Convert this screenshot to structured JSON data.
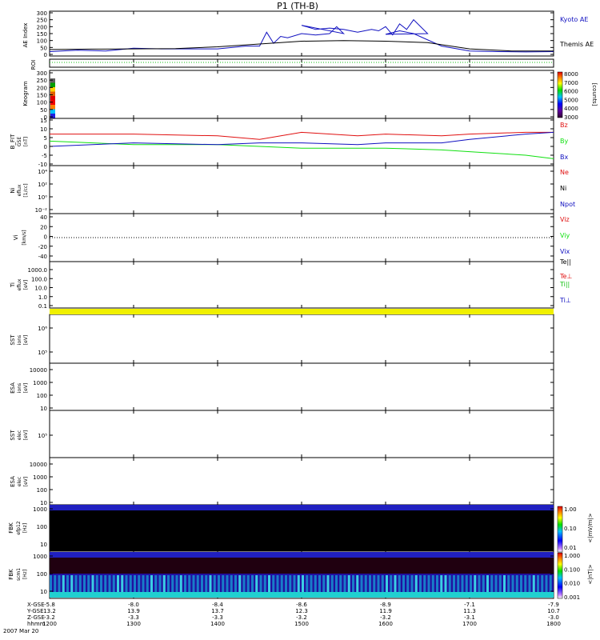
{
  "title": "P1 (TH-B)",
  "date_label": "2007 Mar 20",
  "colors": {
    "red": "#e01010",
    "green": "#10e010",
    "blue": "#1010c0",
    "black": "#000000",
    "yellow": "#f0f000",
    "cyan": "#20d0d0",
    "dark_blue": "#2020c0"
  },
  "x_axis": {
    "tick_labels": [
      "1200",
      "1300",
      "1400",
      "1500",
      "1600",
      "1700",
      "1800"
    ],
    "row_labels": [
      "X-GSE",
      "Y-GSE",
      "Z-GSE",
      "hhmm"
    ],
    "x_gse": [
      "-5.8",
      "-8.0",
      "-8.4",
      "-8.6",
      "-8.9",
      "-7.1",
      "-7.9"
    ],
    "y_gse": [
      "13.2",
      "13.9",
      "13.7",
      "12.3",
      "11.9",
      "11.3",
      "10.7"
    ],
    "z_gse": [
      "-3.2",
      "-3.3",
      "-3.3",
      "-3.2",
      "-3.2",
      "-3.1",
      "-3.0"
    ]
  },
  "panels": {
    "ae": {
      "ylabel": "AE Index",
      "ticks": [
        "300",
        "250",
        "200",
        "150",
        "100",
        "50",
        "0"
      ],
      "legend": [
        "Kyoto AE",
        "Themis AE"
      ]
    },
    "roi": {
      "ylabel": "ROI"
    },
    "keo": {
      "ylabel": "Keogram",
      "ticks": [
        "300",
        "250",
        "200",
        "150",
        "100",
        "50",
        "0"
      ],
      "colorbar": {
        "unit": "[counts]",
        "ticks": [
          "8000",
          "7000",
          "6000",
          "5000",
          "4000",
          "3000"
        ]
      }
    },
    "bfit": {
      "ylabel": "B_FIT",
      "ylabel2": "GSE",
      "unit": "[nT]",
      "ticks": [
        "15",
        "10",
        "5",
        "0",
        "-5",
        "-10"
      ],
      "legend": [
        "Bz",
        "By",
        "Bx"
      ]
    },
    "ni": {
      "ylabel": "Ni",
      "ylabel2": "eflux",
      "unit": "[1/cc]",
      "ticks": [
        "10⁴",
        "10²",
        "10⁰",
        "10⁻²"
      ],
      "legend": [
        "Ne",
        "Ni",
        "Npot"
      ]
    },
    "vi": {
      "ylabel": "Vi",
      "unit": "[km/s]",
      "ticks": [
        "40",
        "20",
        "0",
        "-20",
        "-40"
      ],
      "legend": [
        "Viz",
        "Viy",
        "Vix"
      ]
    },
    "ti": {
      "ylabel": "Ti",
      "ylabel2": "eflux",
      "unit": "[eV]",
      "ticks": [
        "1000.0",
        "100.0",
        "10.0",
        "1.0",
        "0.1"
      ],
      "legend": [
        "Te||",
        "Te⊥",
        "Ti||",
        "Ti⊥"
      ]
    },
    "sst1": {
      "ylabel": "SST",
      "ylabel2": "ions",
      "unit": "[eV]",
      "ticks": [
        "10⁶",
        "10⁵"
      ]
    },
    "esa1": {
      "ylabel": "ESA",
      "ylabel2": "ions",
      "unit": "[eV]",
      "ticks": [
        "10000",
        "1000",
        "100",
        "10"
      ]
    },
    "sst2": {
      "ylabel": "SST",
      "ylabel2": "elec",
      "unit": "[eV]",
      "ticks": [
        "10⁵"
      ]
    },
    "esa2": {
      "ylabel": "ESA",
      "ylabel2": "elec",
      "unit": "[eV]",
      "ticks": [
        "10000",
        "1000",
        "100",
        "10"
      ]
    },
    "fbk1": {
      "ylabel": "FBK",
      "ylabel2": "efp12",
      "unit": "[Hz]",
      "ticks": [
        "1000",
        "100",
        "10"
      ],
      "colorbar": {
        "unit": "<|mV/m|>",
        "ticks": [
          "1.00",
          "0.10",
          "0.01"
        ]
      }
    },
    "fbk2": {
      "ylabel": "FBK",
      "ylabel2": "scm1",
      "unit": "[Hz]",
      "ticks": [
        "1000",
        "100",
        "10"
      ],
      "colorbar": {
        "unit": "<|nT|>",
        "ticks": [
          "1.000",
          "0.100",
          "0.010",
          "0.001"
        ]
      }
    }
  },
  "chart_data": [
    {
      "type": "line",
      "panel": "AE Index",
      "ylim": [
        0,
        300
      ],
      "x_range": [
        1200,
        1800
      ],
      "series": [
        {
          "name": "Kyoto AE",
          "color": "#1010c0",
          "x": [
            1200,
            1220,
            1240,
            1300,
            1320,
            1340,
            1400,
            1420,
            1430,
            1435,
            1440,
            1445,
            1450,
            1460,
            1470,
            1480,
            1485,
            1490,
            1500,
            1510,
            1520,
            1530,
            1540,
            1550,
            1555,
            1560,
            1565,
            1570,
            1575,
            1580,
            1590,
            1600,
            1610,
            1620,
            1640,
            1700,
            1720,
            1740,
            1800
          ],
          "y": [
            20,
            30,
            25,
            45,
            40,
            40,
            40,
            60,
            60,
            160,
            80,
            130,
            120,
            150,
            140,
            150,
            200,
            150,
            210,
            180,
            190,
            180,
            160,
            180,
            170,
            200,
            140,
            220,
            180,
            250,
            150,
            145,
            170,
            150,
            60,
            25,
            20,
            18,
            20
          ]
        },
        {
          "name": "Themis AE",
          "color": "#000000",
          "x": [
            1200,
            1230,
            1300,
            1330,
            1400,
            1430,
            1500,
            1530,
            1600,
            1630,
            1700,
            1730,
            1800
          ],
          "y": [
            35,
            38,
            40,
            42,
            55,
            75,
            95,
            100,
            95,
            85,
            40,
            25,
            25
          ]
        }
      ]
    },
    {
      "type": "line",
      "panel": "B_FIT GSE",
      "ylim": [
        -10,
        15
      ],
      "x_range": [
        1200,
        1800
      ],
      "series": [
        {
          "name": "Bz",
          "color": "#e01010",
          "x": [
            1200,
            1300,
            1400,
            1430,
            1500,
            1540,
            1600,
            1640,
            1700,
            1740,
            1800
          ],
          "y": [
            7,
            7,
            6,
            4,
            8,
            6,
            7,
            6,
            7,
            8,
            8
          ]
        },
        {
          "name": "By",
          "color": "#10e010",
          "x": [
            1200,
            1300,
            1400,
            1430,
            1500,
            1540,
            1600,
            1640,
            1700,
            1740,
            1800
          ],
          "y": [
            3,
            1,
            1,
            0,
            -1,
            -1,
            -1,
            -2,
            -3,
            -5,
            -7
          ]
        },
        {
          "name": "Bx",
          "color": "#1010c0",
          "x": [
            1200,
            1300,
            1400,
            1430,
            1500,
            1540,
            1600,
            1640,
            1700,
            1740,
            1800
          ],
          "y": [
            0,
            2,
            1,
            2,
            2,
            1,
            2,
            2,
            4,
            7,
            8
          ]
        }
      ]
    }
  ]
}
